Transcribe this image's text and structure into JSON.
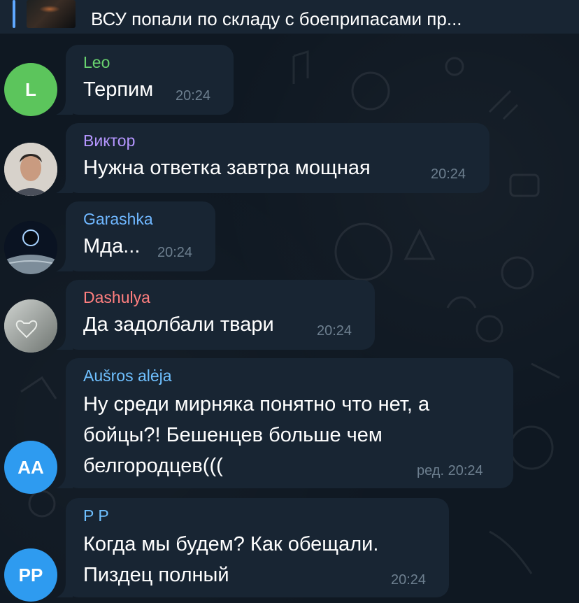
{
  "reply": {
    "text": "ВСУ попали по складу с боеприпасами пр..."
  },
  "messages": [
    {
      "author": "Leo",
      "author_color": "#69d26f",
      "lines": [
        "Терпим"
      ],
      "time": "20:24",
      "avatar": "L",
      "avatar_color": "#5cc55c"
    },
    {
      "author": "Виктор",
      "author_color": "#b596ff",
      "lines": [
        "Нужна ответка завтра мощная"
      ],
      "time": "20:24",
      "avatar": "photo"
    },
    {
      "author": "Garashka",
      "author_color": "#6fb7ff",
      "lines": [
        "Мда..."
      ],
      "time": "20:24",
      "avatar": "photo"
    },
    {
      "author": "Dashulya",
      "author_color": "#ff7f7f",
      "lines": [
        "Да задолбали твари"
      ],
      "time": "20:24",
      "avatar": "photo"
    },
    {
      "author": "Aušros alėja",
      "author_color": "#6fc0ff",
      "lines": [
        "Ну среди мирняка понятно что нет, а",
        "бойцы?! Бешенцев больше чем",
        "белгородцев((("
      ],
      "time": "ред. 20:24",
      "avatar": "AA",
      "avatar_color": "#2e9bf0"
    },
    {
      "author": "P P",
      "author_color": "#6fc0ff",
      "lines": [
        "Когда мы будем? Как обещали.",
        "Пиздец полный"
      ],
      "time": "20:24",
      "avatar": "PP",
      "avatar_color": "#2e9bf0"
    }
  ]
}
